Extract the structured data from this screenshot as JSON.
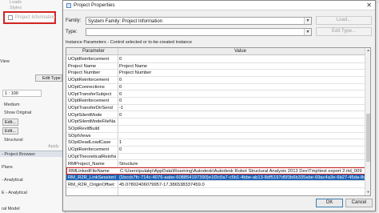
{
  "background_app": {
    "sidebar_items": [
      "Loads",
      "Styles"
    ],
    "project_information_label": "Project Information",
    "view_label": "View",
    "edit_type_label": "Edit Type",
    "scale_value": "1 : 100",
    "detail_level": "Medium",
    "display_mode": "Show Original",
    "edit_button_1": "Edit...",
    "edit_button_2": "Edit...",
    "discipline": "Structural",
    "apply_label": "Apply",
    "browser_title": "- Project Browser",
    "browser_items": [
      "Plans",
      "- Analytical",
      "E - Analytical",
      "ral Model"
    ]
  },
  "dialog": {
    "title": "Project Properties",
    "close_glyph": "✕",
    "family_label": "Family:",
    "family_value": "System Family: Project Information",
    "type_label": "Type:",
    "type_value": "",
    "load_button": "Load...",
    "edit_type_button": "Edit Type...",
    "caption": "Instance Parameters - Control selected or to-be-created instance",
    "col_parameter": "Parameter",
    "col_value": "Value",
    "rows": [
      {
        "name": "UOptReinforcement",
        "value": "0"
      },
      {
        "name": "Project Name",
        "value": "Project Name"
      },
      {
        "name": "Project Number",
        "value": "Project Number"
      },
      {
        "name": "UOptReinforcement",
        "value": "0"
      },
      {
        "name": "UOptConnections",
        "value": "0"
      },
      {
        "name": "UOptTransferSubject",
        "value": "0"
      },
      {
        "name": "UOptReinforcement",
        "value": "0"
      },
      {
        "name": "UOptTransferDirSend",
        "value": "-1"
      },
      {
        "name": "UOptSilentMode",
        "value": "0"
      },
      {
        "name": "UOptSilentModeFileNa",
        "value": ""
      },
      {
        "name": "SOptRevitBuild",
        "value": ""
      },
      {
        "name": "SOptViews",
        "value": ""
      },
      {
        "name": "SOptDeadLoadCase",
        "value": "1"
      },
      {
        "name": "UOptReinforcement",
        "value": "0"
      },
      {
        "name": "UOptTheoreticalReinforc",
        "value": ""
      },
      {
        "name": "RMProject_Name",
        "value": "Structure"
      },
      {
        "name": "RMLinkedFileName",
        "value": "C:\\Users\\pulakp\\AppData\\Roaming\\Autodesk\\Autodesk Robot Structural Analysis 2013 Dev\\Tmp\\test export 2.rtd_009"
      },
      {
        "name": "RM_R2R_LinkSessionID",
        "value": "{1bccb7fc-714c-4076-aabe-608854197390}e1f2c0a7-c5b1-4bbe-ab13-8df5197d5f3b6b335abe-69ac4a3e-6b27-45da-8d-"
      },
      {
        "name": "RM_R2R_OriginOffset",
        "value": "45.07802406079957-17.386538337459.0"
      }
    ],
    "ok_button": "OK",
    "cancel_button": "Cancel"
  }
}
